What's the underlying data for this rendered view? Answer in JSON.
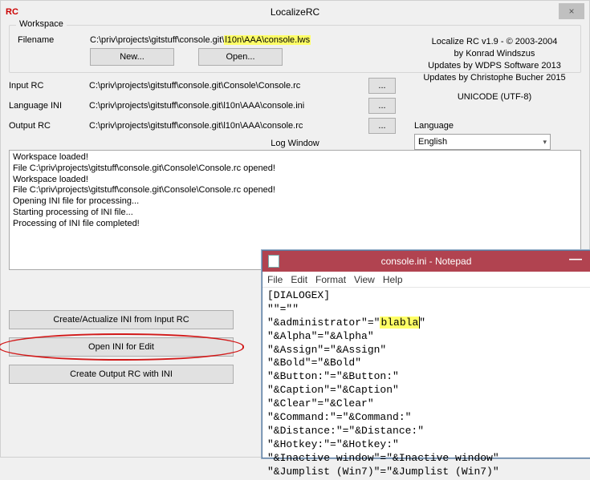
{
  "window": {
    "rc_label": "RC",
    "title": "LocalizeRC",
    "close": "×"
  },
  "workspace": {
    "legend": "Workspace",
    "filename_label": "Filename",
    "filename_prefix": "C:\\priv\\projects\\gitstuff\\console.git\\",
    "filename_highlight": "l10n\\AAA\\console.lws",
    "new_btn": "New...",
    "open_btn": "Open..."
  },
  "about": {
    "line1": "Localize RC v1.9 - © 2003-2004",
    "line2": "by Konrad Windszus",
    "line3": "Updates by WDPS Software 2013",
    "line4": "Updates by Christophe Bucher 2015",
    "line5": "UNICODE (UTF-8)"
  },
  "paths": {
    "input_label": "Input RC",
    "input_value": "C:\\priv\\projects\\gitstuff\\console.git\\Console\\Console.rc",
    "ini_label": "Language INI",
    "ini_value": "C:\\priv\\projects\\gitstuff\\console.git\\l10n\\AAA\\console.ini",
    "output_label": "Output RC",
    "output_value": "C:\\priv\\projects\\gitstuff\\console.git\\l10n\\AAA\\console.rc",
    "browse": "..."
  },
  "language": {
    "label": "Language",
    "value": "English"
  },
  "log": {
    "label": "Log Window",
    "content": "Workspace loaded!\nFile C:\\priv\\projects\\gitstuff\\console.git\\Console\\Console.rc opened!\nWorkspace loaded!\nFile C:\\priv\\projects\\gitstuff\\console.git\\Console\\Console.rc opened!\nOpening INI file for processing...\nStarting processing of INI file...\nProcessing of INI file completed!"
  },
  "actions": {
    "create_ini": "Create/Actualize INI from Input RC",
    "open_ini": "Open INI for Edit",
    "create_rc": "Create Output RC with INI"
  },
  "notepad": {
    "title": "console.ini - Notepad",
    "menu": {
      "file": "File",
      "edit": "Edit",
      "format": "Format",
      "view": "View",
      "help": "Help"
    },
    "lines_pre": "[DIALOGEX]\n\"\"=\"\"\n\"&administrator\"=\"",
    "highlight": "blabla",
    "lines_post": "\"\n\"&Alpha\"=\"&Alpha\"\n\"&Assign\"=\"&Assign\"\n\"&Bold\"=\"&Bold\"\n\"&Button:\"=\"&Button:\"\n\"&Caption\"=\"&Caption\"\n\"&Clear\"=\"&Clear\"\n\"&Command:\"=\"&Command:\"\n\"&Distance:\"=\"&Distance:\"\n\"&Hotkey:\"=\"&Hotkey:\"\n\"&Inactive window\"=\"&Inactive window\"\n\"&Jumplist (Win7)\"=\"&Jumplist (Win7)\""
  }
}
